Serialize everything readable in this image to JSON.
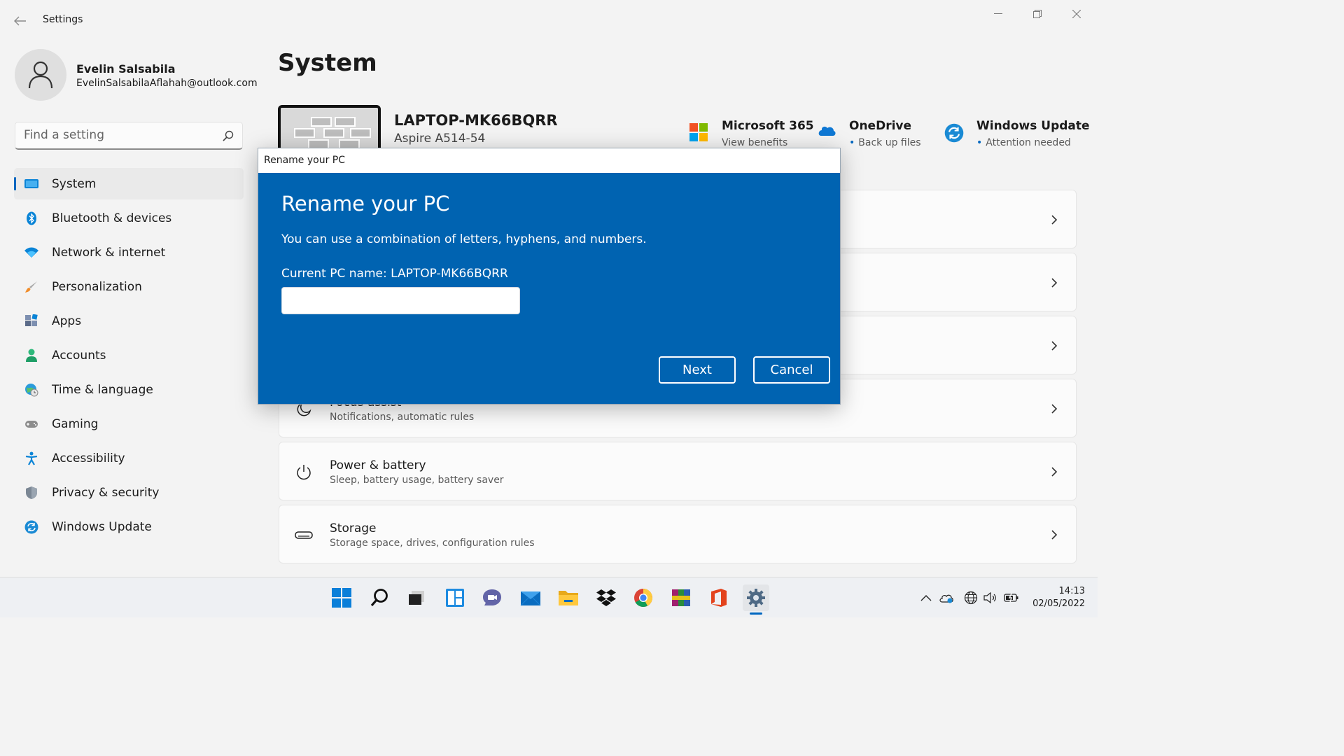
{
  "window": {
    "app_title": "Settings",
    "controls": [
      "minimize",
      "restore",
      "close"
    ]
  },
  "profile": {
    "name": "Evelin Salsabila",
    "email": "EvelinSalsabilaAflahah@outlook.com"
  },
  "search": {
    "placeholder": "Find a setting"
  },
  "nav": {
    "items": [
      {
        "label": "System",
        "icon": "monitor-icon",
        "active": true
      },
      {
        "label": "Bluetooth & devices",
        "icon": "bluetooth-icon"
      },
      {
        "label": "Network & internet",
        "icon": "wifi-icon"
      },
      {
        "label": "Personalization",
        "icon": "brush-icon"
      },
      {
        "label": "Apps",
        "icon": "apps-icon"
      },
      {
        "label": "Accounts",
        "icon": "person-icon"
      },
      {
        "label": "Time & language",
        "icon": "globe-clock-icon"
      },
      {
        "label": "Gaming",
        "icon": "gamepad-icon"
      },
      {
        "label": "Accessibility",
        "icon": "accessibility-icon"
      },
      {
        "label": "Privacy & security",
        "icon": "shield-icon"
      },
      {
        "label": "Windows Update",
        "icon": "update-icon"
      }
    ]
  },
  "main": {
    "title": "System",
    "device": {
      "name": "LAPTOP-MK66BQRR",
      "model": "Aspire A514-54"
    },
    "quick_links": [
      {
        "title": "Microsoft 365",
        "subtitle": "View benefits",
        "icon": "microsoft-logo-icon"
      },
      {
        "title": "OneDrive",
        "subtitle": "Back up files",
        "icon": "onedrive-cloud-icon"
      },
      {
        "title": "Windows Update",
        "subtitle": "Attention needed",
        "icon": "update-icon"
      }
    ],
    "cards": [
      {
        "title": "",
        "subtitle": "",
        "icon": ""
      },
      {
        "title": "",
        "subtitle": "",
        "icon": ""
      },
      {
        "title": "",
        "subtitle": "",
        "icon": ""
      },
      {
        "title": "Focus assist",
        "subtitle": "Notifications, automatic rules",
        "icon": "moon-icon"
      },
      {
        "title": "Power & battery",
        "subtitle": "Sleep, battery usage, battery saver",
        "icon": "power-icon"
      },
      {
        "title": "Storage",
        "subtitle": "Storage space, drives, configuration rules",
        "icon": "drive-icon"
      }
    ]
  },
  "dialog": {
    "window_title": "Rename your PC",
    "heading": "Rename your PC",
    "description": "You can use a combination of letters, hyphens, and numbers.",
    "current_name_label": "Current PC name: LAPTOP-MK66BQRR",
    "input_value": "",
    "next_label": "Next",
    "cancel_label": "Cancel"
  },
  "taskbar": {
    "apps": [
      "start-icon",
      "search-icon",
      "task-view-icon",
      "widgets-icon",
      "chat-icon",
      "mail-icon",
      "file-explorer-icon",
      "dropbox-icon",
      "chrome-icon",
      "winrar-icon",
      "office-icon",
      "settings-icon"
    ],
    "active_app": "settings-icon",
    "tray": [
      "chevron-up-icon",
      "onedrive-sync-icon",
      "language-globe-icon",
      "speaker-icon",
      "battery-icon"
    ],
    "time": "14:13",
    "date": "02/05/2022"
  },
  "colors": {
    "accent": "#0067c0",
    "dialog_bg": "#0063b1",
    "window_bg": "#f3f3f3"
  }
}
